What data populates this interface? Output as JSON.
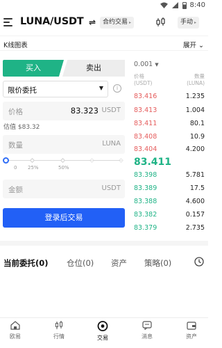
{
  "status_bar": {
    "time": "8:40"
  },
  "header": {
    "pair": "LUNA/USDT",
    "swap_icon": "⇌",
    "contract_label": "合约交易",
    "contract_arrow": "▸",
    "manual_label": "手动",
    "manual_arrow": "▸"
  },
  "kline": {
    "label": "K线图表",
    "expand_label": "展开",
    "expand_caret": "⌄"
  },
  "order_form": {
    "buy_label": "买入",
    "sell_label": "卖出",
    "order_type": "限价委托",
    "order_caret": "▼",
    "info": "i",
    "price_label": "价格",
    "price_value": "83.323",
    "price_unit": "USDT",
    "estimate": "估值 $83.32",
    "qty_label": "数量",
    "qty_unit": "LUNA",
    "slider_ticks": [
      "0",
      "25%",
      "50%"
    ],
    "amount_label": "金额",
    "amount_unit": "USDT",
    "login_button": "登录后交易"
  },
  "order_book": {
    "precision": "0.001",
    "precision_caret": "▼",
    "price_header": "价格",
    "price_unit_header": "(USDT)",
    "qty_header": "数量",
    "qty_unit_header": "(LUNA)",
    "asks": [
      {
        "price": "83.416",
        "qty": "1.235"
      },
      {
        "price": "83.413",
        "qty": "1.004"
      },
      {
        "price": "83.411",
        "qty": "80.1"
      },
      {
        "price": "83.408",
        "qty": "10.9"
      },
      {
        "price": "83.404",
        "qty": "4.200"
      }
    ],
    "last_price": "83.411",
    "bids": [
      {
        "price": "83.398",
        "qty": "5.781"
      },
      {
        "price": "83.389",
        "qty": "17.5"
      },
      {
        "price": "83.388",
        "qty": "4.600"
      },
      {
        "price": "83.382",
        "qty": "0.157"
      },
      {
        "price": "83.379",
        "qty": "2.735"
      }
    ]
  },
  "bottom_tabs": [
    "当前委托(0)",
    "仓位(0)",
    "资产",
    "策略(0)"
  ],
  "nav": [
    "欧易",
    "行情",
    "交易",
    "消息",
    "资产"
  ],
  "colors": {
    "buy": "#1fb386",
    "sell": "#e55c5c",
    "primary": "#2260f6"
  }
}
